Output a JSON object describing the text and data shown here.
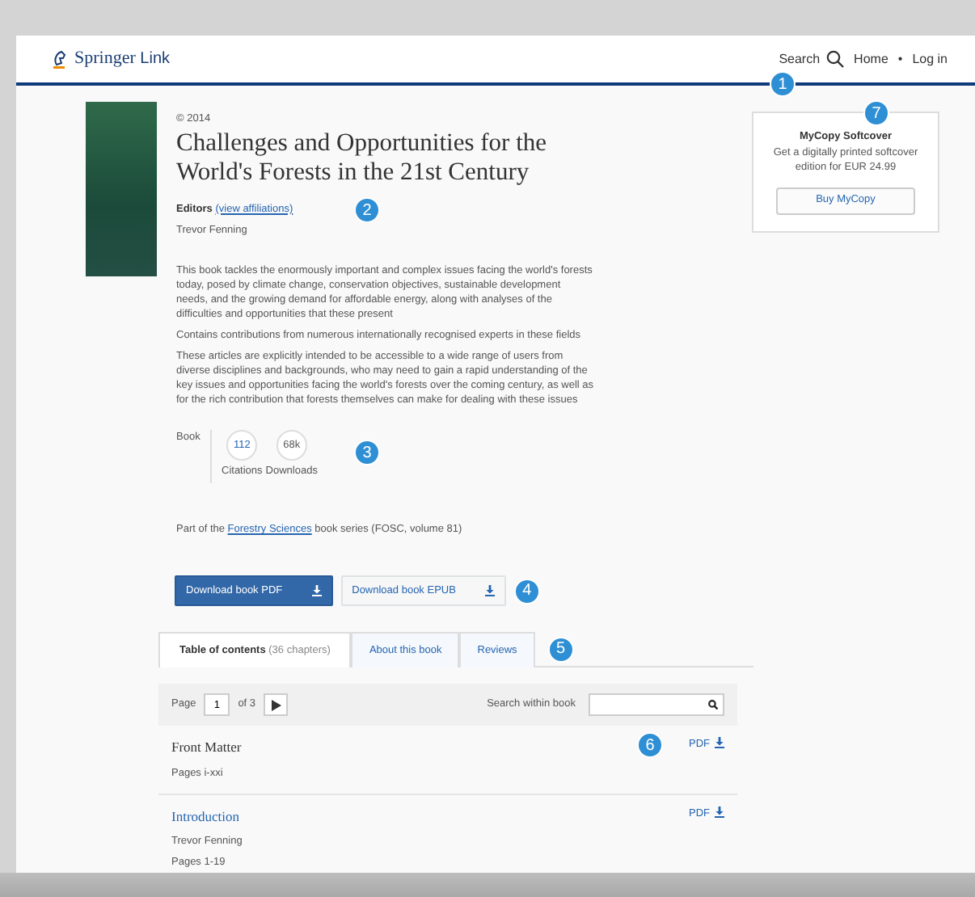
{
  "header": {
    "brand": "Springer",
    "product": "Link",
    "search_label": "Search",
    "links": [
      "Home",
      "Log in"
    ],
    "separator": "•",
    "callout": "1"
  },
  "book": {
    "copyright": "© 2014",
    "title": "Challenges and Opportunities for the World's Forests in the 21st Century",
    "editors_label": "Editors",
    "affiliations_link": "(view affiliations)",
    "editor": "Trevor Fenning",
    "callout": "2",
    "paragraphs": [
      "This book tackles the enormously important and complex issues facing the world's forests today, posed by climate change, conservation objectives, sustainable development needs, and the growing demand for affordable energy, along with analyses of the difficulties and opportunities that these present",
      "Contains contributions from numerous internationally recognised experts in these fields",
      "These articles are explicitly intended to be accessible to a wide range of users from diverse disciplines and backgrounds, who may need to gain a rapid understanding of the key issues and opportunities facing the world's forests over the coming century, as well as for the rich contribution that forests themselves can make for dealing with these issues"
    ],
    "metrics_label": "Book",
    "metrics_callout": "3",
    "metrics": [
      {
        "value": "112",
        "label": "Citations",
        "linked": true
      },
      {
        "value": "68k",
        "label": "Downloads",
        "linked": false
      }
    ],
    "series": {
      "prefix": "Part of the",
      "link": "Forestry Sciences",
      "suffix": "book series (FOSC, volume 81)"
    }
  },
  "mycopy": {
    "title": "MyCopy Softcover",
    "text": "Get a digitally printed softcover edition for EUR 24.99",
    "button": "Buy MyCopy",
    "callout": "7"
  },
  "downloads": {
    "buttons": [
      {
        "label": "Download book PDF",
        "primary": true
      },
      {
        "label": "Download book EPUB",
        "primary": false
      }
    ],
    "callout": "4"
  },
  "tabs": {
    "items": [
      {
        "label": "Table of contents",
        "count": "(36 chapters)",
        "selected": true
      },
      {
        "label": "About this book",
        "selected": false
      },
      {
        "label": "Reviews",
        "selected": false
      }
    ],
    "callout": "5"
  },
  "toc": {
    "page_label": "Page",
    "page_value": "1",
    "page_of": "of 3",
    "search_label": "Search within book",
    "callout": "6",
    "chapters": [
      {
        "title": "Front Matter",
        "linked": false,
        "pages": "Pages i-xxi",
        "pdf": "PDF"
      },
      {
        "title": "Introduction",
        "linked": true,
        "author": "Trevor Fenning",
        "pages": "Pages 1-19",
        "pdf": "PDF"
      }
    ]
  }
}
